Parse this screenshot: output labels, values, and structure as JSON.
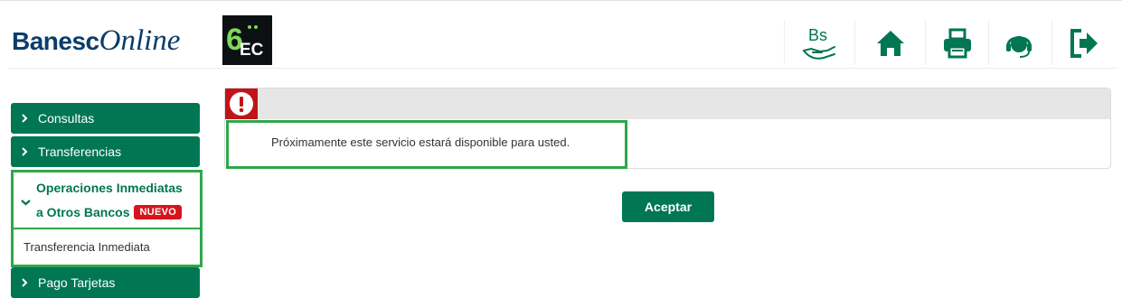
{
  "header": {
    "logo_part1": "Banesc",
    "logo_part2": "Online",
    "badge_text": "EC",
    "badge_number": "6",
    "icons": [
      {
        "name": "currency-bs-icon",
        "label": "Bs"
      },
      {
        "name": "home-icon"
      },
      {
        "name": "print-icon"
      },
      {
        "name": "support-headset-icon"
      },
      {
        "name": "logout-icon"
      }
    ]
  },
  "sidebar": {
    "items": [
      {
        "label": "Consultas"
      },
      {
        "label": "Transferencias"
      },
      {
        "label_line1": "Operaciones Inmediatas",
        "label_line2": "a Otros Bancos",
        "badge": "NUEVO",
        "sub_item": "Transferencia Inmediata"
      },
      {
        "label": "Pago Tarjetas"
      }
    ]
  },
  "message": {
    "text": "Próximamente este servicio estará disponible para usted.",
    "button": "Aceptar"
  },
  "colors": {
    "primary_green": "#007653",
    "highlight_green": "#2ea84a",
    "alert_red": "#c0141a",
    "badge_red": "#d5141b",
    "brand_blue": "#0a3d6b"
  }
}
